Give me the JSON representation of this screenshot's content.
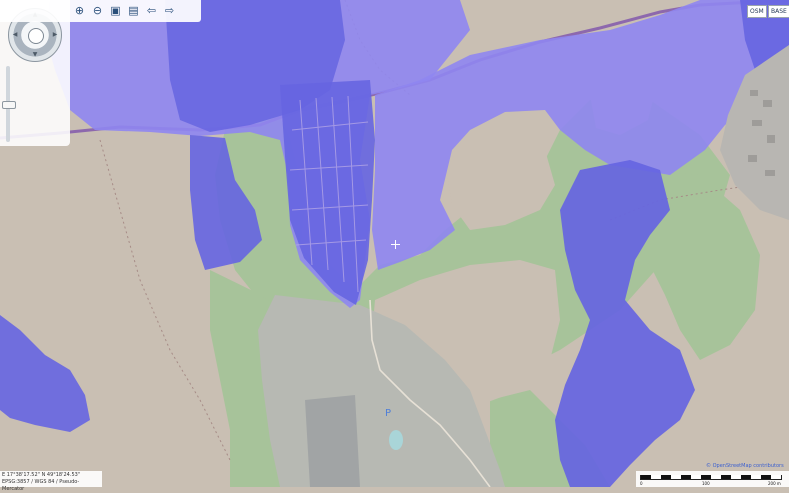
{
  "map": {
    "colors": {
      "background": "#c9bfb3",
      "forest": "#a7c39a",
      "protected_light": "#8f86f1",
      "protected_dark": "#6665e1",
      "road": "#8d68ad",
      "grey_area": "#b7b9b3"
    },
    "icons": {
      "zoom_in": "magnify-plus-icon",
      "zoom_out": "magnify-minus-icon",
      "zoom_box": "zoom-box-icon",
      "zoom_extent": "zoom-extent-icon",
      "back": "arrow-left-icon",
      "forward": "arrow-right-icon"
    }
  },
  "toolbar": {
    "zoom_in_icon": "⊕",
    "zoom_out_icon": "⊖",
    "box_icon": "▣",
    "extent_icon": "▤",
    "back_icon": "⇦",
    "forward_icon": "⇨"
  },
  "layers": {
    "osm_label": "OSM",
    "base_label": "BASE"
  },
  "status": {
    "lon": "E 17°38'17.52\"",
    "lat": "N 49°18'24.53\"",
    "crs": "EPSG:3857 / WGS 84 / Pseudo-Mercator"
  },
  "attribution": "© OpenStreetMap contributors",
  "scale": {
    "labels": [
      "0",
      "100",
      "200 m"
    ]
  },
  "poi": {
    "parking": "P"
  }
}
